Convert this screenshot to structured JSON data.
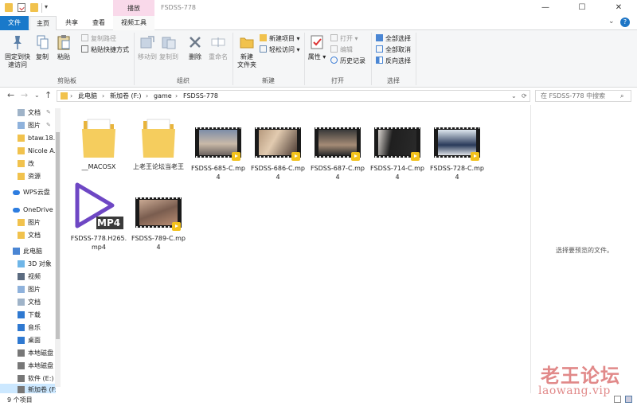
{
  "titlebar": {
    "context_tab": "播放",
    "title": "FSDSS-778",
    "minimize": "—",
    "maximize": "☐",
    "close": "✕"
  },
  "tabs": {
    "file": "文件",
    "home": "主页",
    "share": "共享",
    "view": "查看",
    "video_tools": "视频工具"
  },
  "ribbon": {
    "pin": "固定到快\n速访问",
    "copy": "复制",
    "paste": "粘贴",
    "copy_path": "复制路径",
    "paste_shortcut": "粘贴快捷方式",
    "clipboard": "剪贴板",
    "move_to": "移动到",
    "copy_to": "复制到",
    "delete": "删除",
    "rename": "重命名",
    "organize": "组织",
    "new_folder": "新建\n文件夹",
    "new_item": "新建项目",
    "easy_access": "轻松访问",
    "new": "新建",
    "properties": "属性",
    "open": "打开",
    "edit": "编辑",
    "history": "历史记录",
    "open_group": "打开",
    "select_all": "全部选择",
    "select_none": "全部取消",
    "invert": "反向选择",
    "select_group": "选择"
  },
  "address": {
    "crumbs": [
      "此电脑",
      "新加卷 (F:)",
      "game",
      "FSDSS-778"
    ],
    "search_placeholder": "在 FSDSS-778 中搜索"
  },
  "nav": [
    {
      "label": "文档",
      "icon": "document-icon",
      "pin": true
    },
    {
      "label": "图片",
      "icon": "picture-icon",
      "pin": true
    },
    {
      "label": "btaw.18...",
      "icon": "folder-icon"
    },
    {
      "label": "Nicole A...",
      "icon": "folder-icon"
    },
    {
      "label": "改",
      "icon": "folder-icon"
    },
    {
      "label": "资源",
      "icon": "folder-icon"
    },
    {
      "label": "WPS云盘",
      "icon": "cloud-icon"
    },
    {
      "label": "OneDrive",
      "icon": "onedrive-icon"
    },
    {
      "label": "图片",
      "icon": "folder-icon"
    },
    {
      "label": "文档",
      "icon": "folder-icon"
    },
    {
      "label": "此电脑",
      "icon": "computer-icon"
    },
    {
      "label": "3D 对象",
      "icon": "3d-objects-icon"
    },
    {
      "label": "视频",
      "icon": "video-folder-icon"
    },
    {
      "label": "图片",
      "icon": "picture-icon"
    },
    {
      "label": "文档",
      "icon": "document-icon"
    },
    {
      "label": "下载",
      "icon": "download-icon"
    },
    {
      "label": "音乐",
      "icon": "music-icon"
    },
    {
      "label": "桌面",
      "icon": "desktop-icon"
    },
    {
      "label": "本地磁盘",
      "icon": "drive-icon"
    },
    {
      "label": "本地磁盘",
      "icon": "drive-icon"
    },
    {
      "label": "软件 (E:)",
      "icon": "drive-icon"
    },
    {
      "label": "新加卷 (F:",
      "icon": "drive-icon",
      "selected": true
    }
  ],
  "files": [
    {
      "name": "__MACOSX",
      "type": "folder"
    },
    {
      "name": "上老王论坛当老王",
      "type": "folder"
    },
    {
      "name": "FSDSS-685-C.mp4",
      "type": "video"
    },
    {
      "name": "FSDSS-686-C.mp4",
      "type": "video"
    },
    {
      "name": "FSDSS-687-C.mp4",
      "type": "video"
    },
    {
      "name": "FSDSS-714-C.mp4",
      "type": "video"
    },
    {
      "name": "FSDSS-728-C.mp4",
      "type": "video"
    },
    {
      "name": "FSDSS-778.H265.mp4",
      "type": "mp4",
      "icon_text": "MP4"
    },
    {
      "name": "FSDSS-789-C.mp4",
      "type": "video"
    }
  ],
  "preview": {
    "text": "选择要预览的文件。"
  },
  "status": {
    "count": "9 个项目"
  },
  "watermark": {
    "line1": "老王论坛",
    "line2": "laowang.vip"
  }
}
